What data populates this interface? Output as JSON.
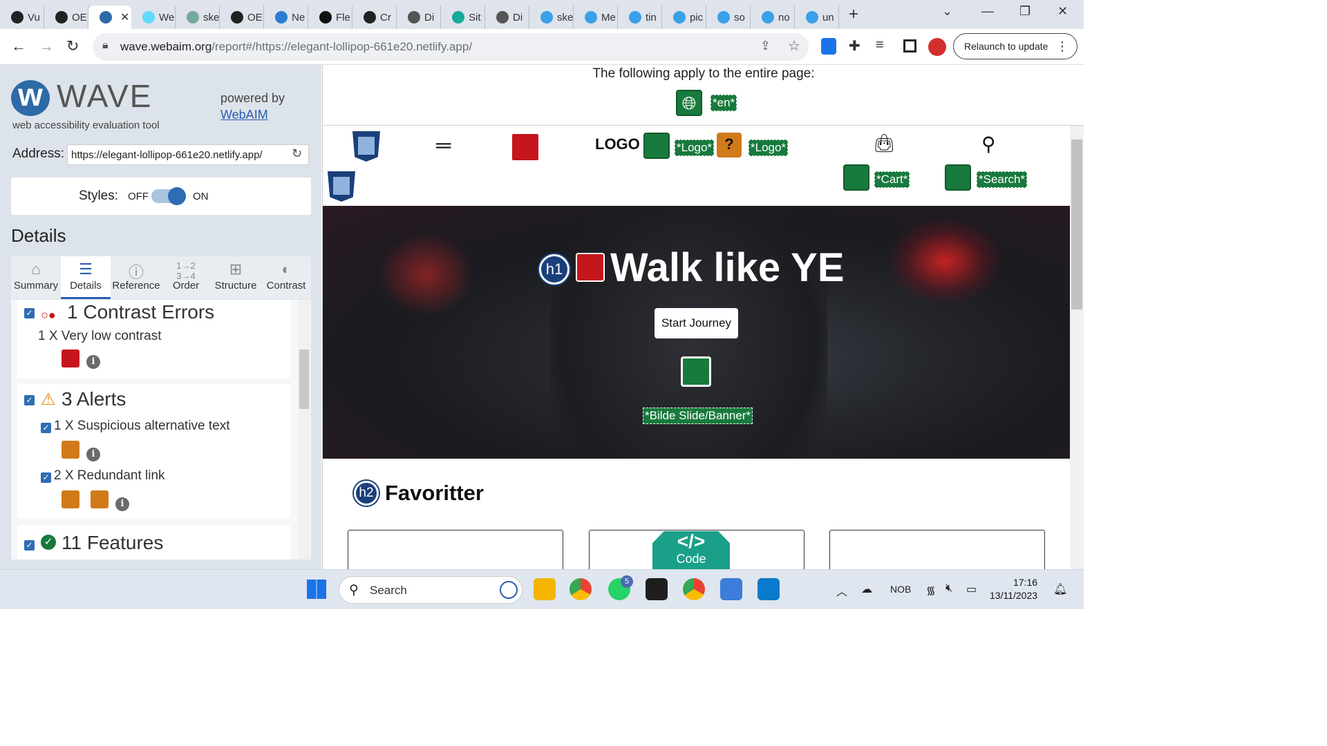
{
  "browser": {
    "tabs": [
      {
        "label": "Vu",
        "color": "#222"
      },
      {
        "label": "OE",
        "color": "#222"
      },
      {
        "label": "",
        "color": "#2e6aa7",
        "active": true
      },
      {
        "label": "We",
        "color": "#61dafb"
      },
      {
        "label": "ske",
        "color": "#74aa9c"
      },
      {
        "label": "OE",
        "color": "#222"
      },
      {
        "label": "Ne",
        "color": "#2b7cd3"
      },
      {
        "label": "Fle",
        "color": "#111"
      },
      {
        "label": "Cr",
        "color": "#222"
      },
      {
        "label": "Di",
        "color": "#555"
      },
      {
        "label": "Sit",
        "color": "#18a999"
      },
      {
        "label": "Di",
        "color": "#555"
      },
      {
        "label": "ske",
        "color": "#3aa0e8"
      },
      {
        "label": "Me",
        "color": "#3aa0e8"
      },
      {
        "label": "tin",
        "color": "#3aa0e8"
      },
      {
        "label": "pic",
        "color": "#3aa0e8"
      },
      {
        "label": "so",
        "color": "#3aa0e8"
      },
      {
        "label": "no",
        "color": "#3aa0e8"
      },
      {
        "label": "un",
        "color": "#3aa0e8"
      }
    ],
    "new_tab": "+",
    "url_host": "wave.webaim.org",
    "url_path": "/report#/https://elegant-lollipop-661e20.netlify.app/",
    "relaunch_label": "Relaunch to update"
  },
  "wave": {
    "title": "WAVE",
    "subtitle": "web accessibility evaluation tool",
    "powered_by": "powered by",
    "webaim_link": "WebAIM",
    "address_label": "Address:",
    "address_value": "https://elegant-lollipop-661e20.netlify.app/",
    "styles_label": "Styles:",
    "styles_off": "OFF",
    "styles_on": "ON",
    "details_heading": "Details",
    "tabs": [
      "Summary",
      "Details",
      "Reference",
      "Order",
      "Structure",
      "Contrast"
    ],
    "active_tab": "Details",
    "groups": {
      "contrast": {
        "title": "1 Contrast Errors",
        "item": "1 X Very low contrast"
      },
      "alerts": {
        "title": "3 Alerts",
        "items": [
          "1 X Suspicious alternative text",
          "2 X Redundant link"
        ]
      },
      "features": {
        "title": "11 Features"
      }
    }
  },
  "page": {
    "apply_text": "The following apply to the entire page:",
    "lang_label": "*en*",
    "logo_text": "LOGO",
    "logo_alt_1": "*Logo*",
    "logo_alt_2": "*Logo*",
    "cart_label": "*Cart*",
    "search_label": "*Search*",
    "hero_title": "Walk like YE",
    "h1_badge": "h1",
    "start_button": "Start Journey",
    "banner_label": "*Bilde Slide/Banner*",
    "h2_badge": "h2",
    "favoritter": "Favoritter",
    "code_badge": "Code",
    "code_glyph": "</>"
  },
  "taskbar": {
    "search_placeholder": "Search",
    "lang": "NOB",
    "time": "17:16",
    "date": "13/11/2023",
    "whatsapp_badge": "5"
  }
}
